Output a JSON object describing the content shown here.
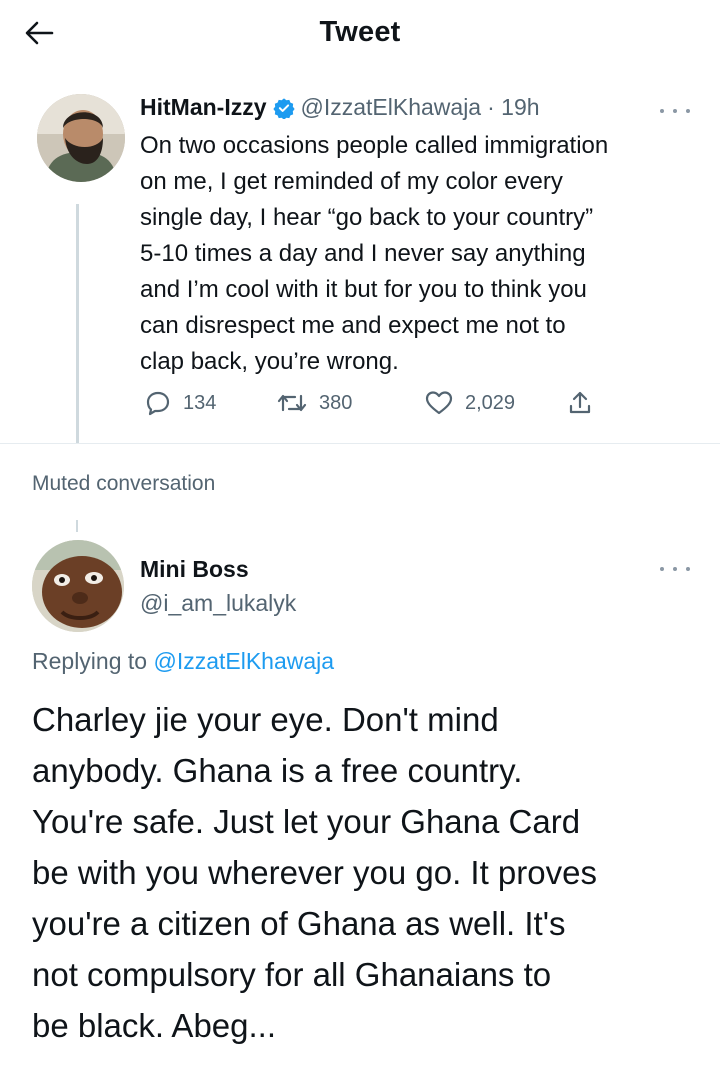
{
  "header": {
    "title": "Tweet",
    "back_icon": "arrow-left-icon"
  },
  "tweet": {
    "display_name": "HitMan-Izzy",
    "verified_icon": "verified-badge-icon",
    "handle": "@IzzatElKhawaja",
    "time": "· 19h",
    "more_icon": "more-horizontal-icon",
    "text": "On two occasions people called immigration\non me, I get reminded of my color every\nsingle day, I hear “go back to your country”\n5-10 times a day and I never say anything\nand I’m cool with it but for you to think you\ncan disrespect me and expect me not to\nclap back, you’re wrong.",
    "replies": "134",
    "retweets": "380",
    "likes": "2,029"
  },
  "muted_label": "Muted conversation",
  "reply": {
    "display_name": "Mini Boss",
    "handle": "@i_am_lukalyk",
    "more_icon": "more-horizontal-icon",
    "replying_prefix": "Replying to ",
    "replying_to": "@IzzatElKhawaja",
    "text": "Charley jie your eye. Don't mind\nanybody. Ghana is a free country.\nYou're safe. Just let your Ghana Card\nbe with you wherever you go. It proves\nyou're a citizen of Ghana as well. It's\nnot compulsory for all Ghanaians to\nbe black. Abeg..."
  },
  "colors": {
    "accent": "#1d9bf0",
    "secondary_text": "#536471",
    "primary_text": "#0f1419",
    "divider": "#e6ecf0"
  }
}
